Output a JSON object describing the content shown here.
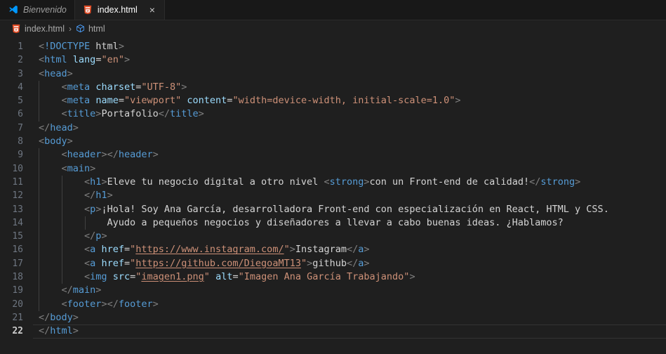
{
  "window": {
    "app": "vscode",
    "bg": "#1f1f1f"
  },
  "tabs": [
    {
      "label": "Bienvenido",
      "icon": "vscode-logo-icon",
      "active": false,
      "closable": false
    },
    {
      "label": "index.html",
      "icon": "html5-icon",
      "active": true,
      "closable": true,
      "close_label": "×"
    }
  ],
  "breadcrumbs": {
    "separator": "›",
    "items": [
      {
        "label": "index.html",
        "icon": "html5-icon"
      },
      {
        "label": "html",
        "icon": "cube-icon"
      }
    ]
  },
  "editor": {
    "language": "html",
    "current_line": 22,
    "total_lines": 22,
    "line_numbers": [
      "1",
      "2",
      "3",
      "4",
      "5",
      "6",
      "7",
      "8",
      "9",
      "10",
      "11",
      "12",
      "13",
      "14",
      "15",
      "16",
      "17",
      "18",
      "19",
      "20",
      "21",
      "22"
    ],
    "lines": [
      {
        "n": "1",
        "text": "<!DOCTYPE html>"
      },
      {
        "n": "2",
        "text": "<html lang=\"en\">"
      },
      {
        "n": "3",
        "text": "<head>"
      },
      {
        "n": "4",
        "text": "    <meta charset=\"UTF-8\">"
      },
      {
        "n": "5",
        "text": "    <meta name=\"viewport\" content=\"width=device-width, initial-scale=1.0\">"
      },
      {
        "n": "6",
        "text": "    <title>Portafolio</title>"
      },
      {
        "n": "7",
        "text": "</head>"
      },
      {
        "n": "8",
        "text": "<body>"
      },
      {
        "n": "9",
        "text": "    <header></header>"
      },
      {
        "n": "10",
        "text": "    <main>"
      },
      {
        "n": "11",
        "text": "        <h1>Eleve tu negocio digital a otro nivel <strong>con un Front-end de calidad!</strong>"
      },
      {
        "n": "12",
        "text": "        </h1>"
      },
      {
        "n": "13",
        "text": "        <p>¡Hola! Soy Ana García, desarrolladora Front-end con especialización en React, HTML y CSS."
      },
      {
        "n": "14",
        "text": "            Ayudo a pequeños negocios y diseñadores a llevar a cabo buenas ideas. ¿Hablamos?"
      },
      {
        "n": "15",
        "text": "        </p>"
      },
      {
        "n": "16",
        "text": "        <a href=\"https://www.instagram.com/\">Instagram</a>"
      },
      {
        "n": "17",
        "text": "        <a href=\"https://github.com/DiegoaMT13\">github</a>"
      },
      {
        "n": "18",
        "text": "        <img src=\"imagen1.png\" alt=\"Imagen Ana García Trabajando\">"
      },
      {
        "n": "19",
        "text": "    </main>"
      },
      {
        "n": "20",
        "text": "    <footer></footer>"
      },
      {
        "n": "21",
        "text": "</body>"
      },
      {
        "n": "22",
        "text": "</html>"
      }
    ],
    "strings": {
      "doctype": "<!DOCTYPE html>",
      "lang_attr": "lang",
      "lang_value": "\"en\"",
      "charset_attr": "charset",
      "charset_value": "\"UTF-8\"",
      "name_attr": "name",
      "name_value": "\"viewport\"",
      "content_attr": "content",
      "content_value": "\"width=device-width, initial-scale=1.0\"",
      "title_text": "Portafolio",
      "h1_text_1": "Eleve tu negocio digital a otro nivel ",
      "strong_text": "con un Front-end de calidad!",
      "p_text_1": "¡Hola! Soy Ana García, desarrolladora Front-end con especialización en React, HTML y CSS.",
      "p_text_2": "Ayudo a pequeños negocios y diseñadores a llevar a cabo buenas ideas. ¿Hablamos?",
      "href_attr": "href",
      "instagram_url": "https://www.instagram.com/",
      "instagram_text": "Instagram",
      "github_url": "https://github.com/DiegoaMT13",
      "github_text": "github",
      "src_attr": "src",
      "img_src": "imagen1.png",
      "alt_attr": "alt",
      "img_alt": "Imagen Ana García Trabajando"
    }
  },
  "colors": {
    "editor_bg": "#1f1f1f",
    "tabbar_bg": "#181818",
    "tag": "#569cd6",
    "attribute": "#9cdcfe",
    "string": "#ce9178",
    "text": "#d4d4d4",
    "punctuation": "#808080",
    "line_number": "#6e7681",
    "html5_orange": "#e44d26",
    "vscode_blue": "#0098ff"
  }
}
